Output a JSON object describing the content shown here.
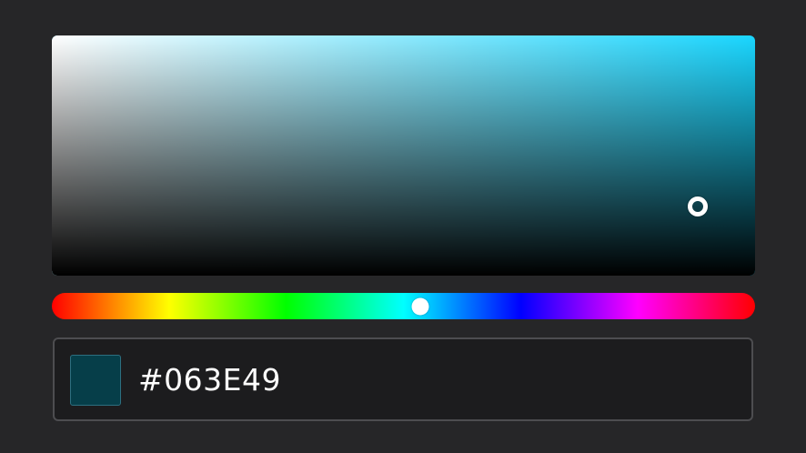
{
  "color": {
    "hex": "#063E49",
    "hue_fraction": 0.525,
    "saturation_fraction": 0.918,
    "value_fraction": 0.287
  },
  "colors": {
    "background": "#262628",
    "hue_pure": "#1ad6ff",
    "input_border": "#4d4d50",
    "input_background": "#1c1c1e",
    "thumb": "#ffffff"
  },
  "icons": {
    "sv_thumb": "ring-handle",
    "hue_thumb": "dot-handle"
  }
}
